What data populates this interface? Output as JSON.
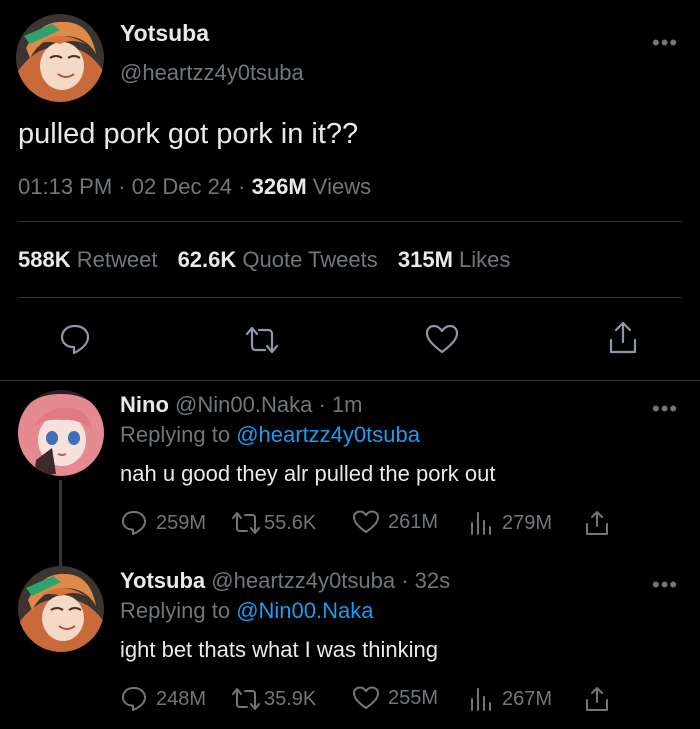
{
  "colors": {
    "background": "#000000",
    "text": "#e7e9ea",
    "muted": "#71767b",
    "link": "#1d9bf0",
    "divider": "#2f3336"
  },
  "main_tweet": {
    "display_name": "Yotsuba",
    "handle": "@heartzz4y0tsuba",
    "text": "pulled pork got pork in it??",
    "time": "01:13 PM",
    "sep1": "·",
    "date": "02 Dec 24",
    "sep2": "·",
    "views_count": "326M",
    "views_label": "Views",
    "stats": {
      "retweets_count": "588K",
      "retweets_label": "Retweet",
      "quotes_count": "62.6K",
      "quotes_label": "Quote Tweets",
      "likes_count": "315M",
      "likes_label": "Likes"
    },
    "actions": [
      "reply-icon",
      "retweet-icon",
      "like-icon",
      "share-icon"
    ]
  },
  "replies": [
    {
      "display_name": "Nino",
      "handle": "@Nin00.Naka",
      "sep": "·",
      "time": "1m",
      "replying_prefix": "Replying to",
      "replying_to": "@heartzz4y0tsuba",
      "text": "nah u good they alr pulled the pork out",
      "reply_count": "259M",
      "retweet_count": "55.6K",
      "like_count": "261M",
      "view_count": "279M"
    },
    {
      "display_name": "Yotsuba",
      "handle": "@heartzz4y0tsuba",
      "sep": "·",
      "time": "32s",
      "replying_prefix": "Replying to",
      "replying_to": "@Nin00.Naka",
      "text": "ight bet thats what I was thinking",
      "reply_count": "248M",
      "retweet_count": "35.9K",
      "like_count": "255M",
      "view_count": "267M"
    }
  ]
}
